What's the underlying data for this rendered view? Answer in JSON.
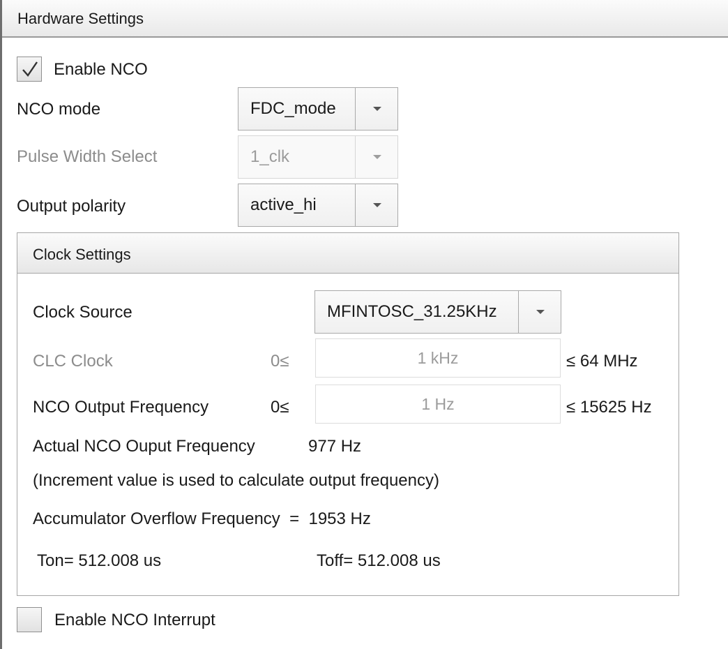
{
  "header": {
    "title": "Hardware Settings"
  },
  "enable_nco": {
    "label": "Enable NCO",
    "checked": true
  },
  "nco_mode": {
    "label": "NCO mode",
    "value": "FDC_mode"
  },
  "pulse_width": {
    "label": "Pulse Width Select",
    "value": "1_clk",
    "disabled": true
  },
  "output_polarity": {
    "label": "Output polarity",
    "value": "active_hi"
  },
  "clock_settings": {
    "title": "Clock Settings",
    "clock_source": {
      "label": "Clock Source",
      "value": "MFINTOSC_31.25KHz"
    },
    "clc_clock": {
      "label": "CLC Clock",
      "min": "0≤",
      "value": "1 kHz",
      "max": "≤ 64 MHz"
    },
    "nco_output": {
      "label": "NCO Output Frequency",
      "min": "0≤",
      "value": "1 Hz",
      "max": "≤ 15625 Hz"
    },
    "actual_freq": {
      "label": "Actual NCO Ouput Frequency",
      "value": "977 Hz"
    },
    "note": "(Increment value is used to calculate output frequency)",
    "accumulator": "Accumulator Overflow Frequency  =  1953 Hz",
    "ton": "Ton= 512.008 us",
    "toff": "Toff= 512.008 us"
  },
  "enable_interrupt": {
    "label": "Enable NCO Interrupt",
    "checked": false
  },
  "icons": {
    "checkmark": "check-icon",
    "dropdown": "chevron-down-icon"
  }
}
